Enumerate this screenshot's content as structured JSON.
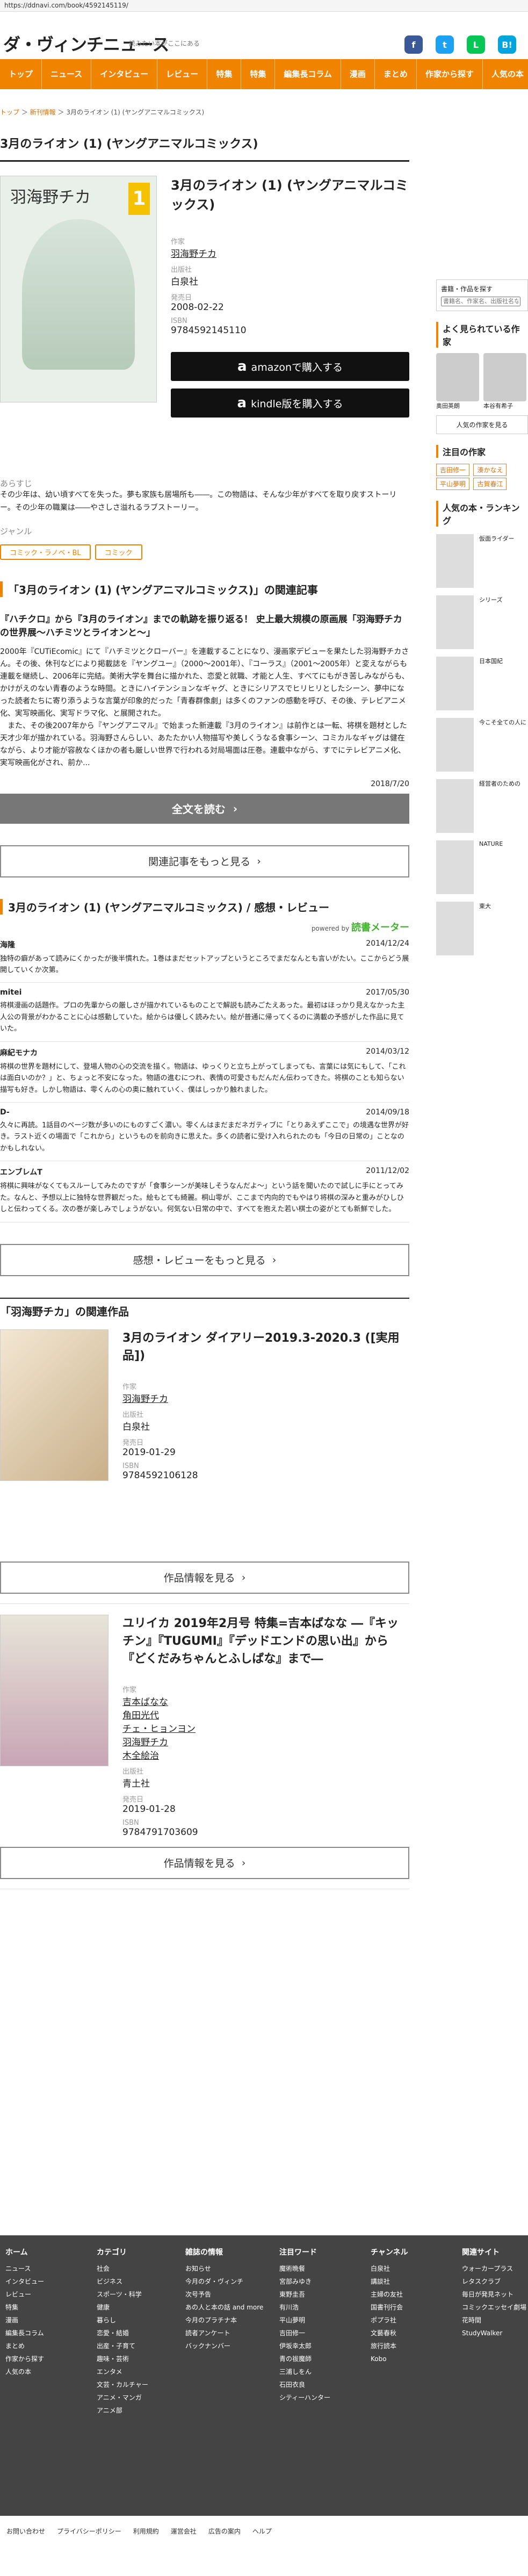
{
  "browser": {
    "url": "https://ddnavi.com/book/4592145119/"
  },
  "header": {
    "logo": "ダ・ヴィンチニュース",
    "tagline": "読みたい本がここにある",
    "social": [
      {
        "glyph": "f",
        "color": "#3b5998"
      },
      {
        "glyph": "t",
        "color": "#1da1f2"
      },
      {
        "glyph": "L",
        "color": "#06c755"
      },
      {
        "glyph": "B!",
        "color": "#00a4de"
      }
    ]
  },
  "nav": [
    "トップ",
    "ニュース",
    "インタビュー",
    "レビュー",
    "特集",
    "特集",
    "編集長コラム",
    "漫画",
    "まとめ",
    "作家から探す",
    "人気の本"
  ],
  "breadcrumb": [
    "トップ",
    "新刊情報",
    "3月のライオン (1) (ヤングアニマルコミックス)"
  ],
  "book": {
    "title": "3月のライオン (1) (ヤングアニマルコミックス)",
    "cover_author": "羽海野チカ",
    "cover_vol": "1",
    "author_label": "作家",
    "author": "羽海野チカ",
    "publisher_label": "出版社",
    "publisher": "白泉社",
    "date_label": "発売日",
    "date": "2008-02-22",
    "isbn_label": "ISBN",
    "isbn": "9784592145110",
    "amazon_btn": "amazonで購入する",
    "kindle_btn": "kindle版を購入する",
    "synopsis_label": "あらすじ",
    "synopsis": "その少年は、幼い頃すべてを失った。夢も家族も居場所も――。この物語は、そんな少年がすべてを取り戻すストーリー。その少年の職業は――やさしさ溢れるラブストーリー。",
    "genre_label": "ジャンル",
    "genres": [
      "コミック・ラノベ・BL",
      "コミック"
    ]
  },
  "related_article": {
    "heading": "「3月のライオン (1) (ヤングアニマルコミックス)」の関連記事",
    "title": "『ハチクロ』から『3月のライオン』までの軌跡を振り返る！ 史上最大規模の原画展「羽海野チカの世界展～ハチミツとライオンと～」",
    "body": "2000年『CUTiEcomic』にて『ハチミツとクローバー』を連載することになり、漫画家デビューを果たした羽海野チカさん。その後、休刊などにより掲載誌を『ヤングユー』（2000〜2001年）、『コーラス』（2001〜2005年）と変えながらも連載を継続し、2006年に完結。美術大学を舞台に描かれた、恋愛と就職、才能と人生、すべてにもがき苦しみながらも、かけがえのない青春のような時間。ときにハイテンションなギャグ、ときにシリアスでヒリヒリとしたシーン、夢中になった読者たちに寄り添うような言葉が印象的だった「青春群像劇」は多くのファンの感動を呼び、その後、テレビアニメ化、実写映画化、実写ドラマ化、と展開された。\n　また、その後2007年から『ヤングアニマル』で始まった新連載『3月のライオン』は前作とは一転、将棋を題材とした天才少年が描かれている。羽海野さんらしい、あたたかい人物描写や美しくうなる食事シーン、コミカルなギャグは健在ながら、より才能が容赦なくほかの者も厳しい世界で行われる対局場面は圧巻。連載中ながら、すでにテレビアニメ化、実写映画化がされ、前か...",
    "date": "2018/7/20",
    "read_btn": "全文を読む",
    "more_btn": "関連記事をもっと見る"
  },
  "reviews_section": {
    "heading": "3月のライオン (1) (ヤングアニマルコミックス) / 感想・レビュー",
    "powered": "powered by",
    "brand": "読書メーター",
    "more_btn": "感想・レビューをもっと見る",
    "items": [
      {
        "user": "海隆",
        "date": "2014/12/24",
        "text": "独特の癖があって読みにくかったが後半慣れた。1巻はまだセットアップというところでまだなんとも言いがたい。ここからどう展開していくか次第。"
      },
      {
        "user": "mitei",
        "date": "2017/05/30",
        "text": "将棋漫画の話題作。プロの先輩からの厳しさが描かれているものことで解説も読みごたえあった。最初はほっかり見えなかった主人公の背景がわかることに心は感動していた。絵からは優しく読みたい。絵が普通に帰ってくるのに満載の予感がした作品に見ていた。"
      },
      {
        "user": "麻紀モナカ",
        "date": "2014/03/12",
        "text": "将棋の世界を題材にして、登場人物の心の交流を描く。物語は、ゆっくりと立ち上がってしまっても、言葉には気にもして、「これは面白いのか？」と、ちょっと不安になった。物語の進むにつれ、表情の可愛さもだんだん伝わってきた。将棋のことも知らない描写も好き。しかし物語は、零くんの心の奥に触れていく、僕はしっかり触れました。"
      },
      {
        "user": "D-",
        "date": "2014/09/18",
        "text": "久々に再読。1話目のページ数が多いのにものすごく濃い。零くんはまだまだネガティブに「とりあえずここで」の境遇な世界が好き。ラスト近くの場面で「これから」というものを前向きに思えた。多くの読者に受け入れられたのも「今日の日常の」ことなのかもしれない。"
      },
      {
        "user": "エンブレムT",
        "date": "2011/12/02",
        "text": "将棋に興味がなくてもスルーしてみたのですが「食事シーンが美味しそうなんだよ〜」という話を聞いたので試しに手にとってみた。なんと、予想以上に独特な世界観だった。絵もとても綺麗。桐山零が、ここまで内向的でもやはり将棋の深みと重みがひしひしと伝わってくる。次の巻が楽しみでしょうがない。何気ない日常の中で、すべてを抱えた若い棋士の姿がとても新鮮でした。"
      }
    ]
  },
  "works_section": {
    "heading": "「羽海野チカ」の関連作品",
    "author_label": "作家",
    "publisher_label": "出版社",
    "date_label": "発売日",
    "isbn_label": "ISBN",
    "more_btn": "作品情報を見る",
    "items": [
      {
        "title": "3月のライオン ダイアリー2019.3-2020.3 ([実用品])",
        "authors": [
          "羽海野チカ"
        ],
        "publisher": "白泉社",
        "date": "2019-01-29",
        "isbn": "9784592106128"
      },
      {
        "title": "ユリイカ 2019年2月号 特集=吉本ばなな ―『キッチン』『TUGUMI』『デッドエンドの思い出』から『どくだみちゃんとふしばな』まで―",
        "authors": [
          "吉本ばなな",
          "角田光代",
          "チェ・ヒョンヨン",
          "羽海野チカ",
          "木全絵治"
        ],
        "publisher": "青土社",
        "date": "2019-01-28",
        "isbn": "9784791703609"
      }
    ]
  },
  "sidebar": {
    "search_label": "書籍・作品を探す",
    "search_placeholder": "書籍名、作家名、出版社名など入力",
    "popular_authors_heading": "よく見られている作家",
    "popular_authors": [
      "奥田英朗",
      "本谷有希子"
    ],
    "authors_more": "人気の作家を見る",
    "keywords_heading": "注目の作家",
    "keywords": [
      "吉田修一",
      "湊かなえ",
      "平山夢明",
      "古賀春江"
    ],
    "books_heading": "人気の本・ランキング",
    "books": [
      "仮面ライダー",
      "シリーズ",
      "日本国紀",
      "今こそ全ての人に",
      "経営者のための",
      "NATURE",
      "東大"
    ]
  },
  "footer": {
    "cols": [
      {
        "h": "ホーム",
        "items": [
          "ニュース",
          "インタビュー",
          "レビュー",
          "特集",
          "漫画",
          "編集長コラム",
          "まとめ",
          "作家から探す",
          "人気の本"
        ]
      },
      {
        "h": "カテゴリ",
        "items": [
          "社会",
          "ビジネス",
          "スポーツ・科学",
          "健康",
          "暮らし",
          "恋愛・結婚",
          "出産・子育て",
          "趣味・芸術",
          "エンタメ",
          "文芸・カルチャー",
          "アニメ・マンガ",
          "アニメ部"
        ]
      },
      {
        "h": "雑誌の情報",
        "items": [
          "お知らせ",
          "今月のダ・ヴィンチ",
          "次号予告",
          "あの人と本の話 and more",
          "今月のプラチナ本",
          "読者アンケート",
          "バックナンバー"
        ]
      },
      {
        "h": "注目ワード",
        "items": [
          "魔術晩餐",
          "宮部みゆき",
          "東野圭吾",
          "有川浩",
          "平山夢明",
          "吉田修一",
          "伊坂幸太郎",
          "青の祓魔師",
          "三浦しをん",
          "石田衣良",
          "シティーハンター"
        ]
      },
      {
        "h": "チャンネル",
        "items": [
          "白泉社",
          "講談社",
          "主婦の友社",
          "国書刊行会",
          "ポプラ社",
          "文藝春秋",
          "旅行読本",
          "Kobo"
        ]
      },
      {
        "h": "関連サイト",
        "items": [
          "ウォーカープラス",
          "レタスクラブ",
          "毎日が発見ネット",
          "コミックエッセイ劇場",
          "花時間",
          "StudyWalker"
        ]
      }
    ],
    "bottom_links": [
      "お問い合わせ",
      "プライバシーポリシー",
      "利用規約",
      "運営会社",
      "広告の案内",
      "ヘルプ"
    ]
  }
}
